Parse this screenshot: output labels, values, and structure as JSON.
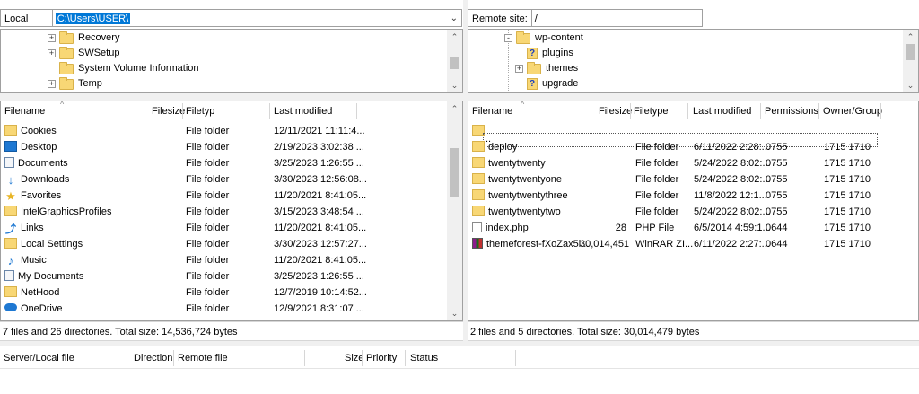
{
  "local": {
    "site_label": "Local site:",
    "path": "C:\\Users\\USER\\",
    "tree": [
      {
        "label": "Recovery",
        "expander": "+"
      },
      {
        "label": "SWSetup",
        "expander": "+"
      },
      {
        "label": "System Volume Information",
        "expander": ""
      },
      {
        "label": "Temp",
        "expander": "+"
      }
    ],
    "columns": {
      "name": "Filename",
      "size": "Filesize",
      "type": "Filetyp",
      "modified": "Last modified"
    },
    "files": [
      {
        "name": "Cookies",
        "size": "",
        "type": "File folder",
        "modified": "12/11/2021 11:11:4...",
        "icon": "folder-icon"
      },
      {
        "name": "Desktop",
        "size": "",
        "type": "File folder",
        "modified": "2/19/2023 3:02:38 ...",
        "icon": "desktop-icon"
      },
      {
        "name": "Documents",
        "size": "",
        "type": "File folder",
        "modified": "3/25/2023 1:26:55 ...",
        "icon": "documents-icon"
      },
      {
        "name": "Downloads",
        "size": "",
        "type": "File folder",
        "modified": "3/30/2023 12:56:08...",
        "icon": "download-icon"
      },
      {
        "name": "Favorites",
        "size": "",
        "type": "File folder",
        "modified": "11/20/2021 8:41:05...",
        "icon": "star-icon"
      },
      {
        "name": "IntelGraphicsProfiles",
        "size": "",
        "type": "File folder",
        "modified": "3/15/2023 3:48:54 ...",
        "icon": "folder-icon"
      },
      {
        "name": "Links",
        "size": "",
        "type": "File folder",
        "modified": "11/20/2021 8:41:05...",
        "icon": "link-icon"
      },
      {
        "name": "Local Settings",
        "size": "",
        "type": "File folder",
        "modified": "3/30/2023 12:57:27...",
        "icon": "folder-icon"
      },
      {
        "name": "Music",
        "size": "",
        "type": "File folder",
        "modified": "11/20/2021 8:41:05...",
        "icon": "music-icon"
      },
      {
        "name": "My Documents",
        "size": "",
        "type": "File folder",
        "modified": "3/25/2023 1:26:55 ...",
        "icon": "documents-icon"
      },
      {
        "name": "NetHood",
        "size": "",
        "type": "File folder",
        "modified": "12/7/2019 10:14:52...",
        "icon": "folder-icon"
      },
      {
        "name": "OneDrive",
        "size": "",
        "type": "File folder",
        "modified": "12/9/2021 8:31:07 ...",
        "icon": "cloud-icon"
      }
    ],
    "status": "7 files and 26 directories. Total size: 14,536,724 bytes"
  },
  "remote": {
    "site_label": "Remote site:",
    "path": "/",
    "tree": [
      {
        "label": "wp-content",
        "kind": "folder",
        "expander": "-"
      },
      {
        "label": "plugins",
        "kind": "unknown",
        "expander": ""
      },
      {
        "label": "themes",
        "kind": "folder",
        "expander": "+"
      },
      {
        "label": "upgrade",
        "kind": "unknown",
        "expander": ""
      }
    ],
    "columns": {
      "name": "Filename",
      "size": "Filesize",
      "type": "Filetype",
      "modified": "Last modified",
      "permissions": "Permissions",
      "owner": "Owner/Group"
    },
    "files": [
      {
        "name": "..",
        "size": "",
        "type": "",
        "modified": "",
        "permissions": "",
        "owner": "",
        "icon": "folder-icon"
      },
      {
        "name": "deploy",
        "size": "",
        "type": "File folder",
        "modified": "6/11/2022 2:28:...",
        "permissions": "0755",
        "owner": "1715 1710",
        "icon": "folder-icon"
      },
      {
        "name": "twentytwenty",
        "size": "",
        "type": "File folder",
        "modified": "5/24/2022 8:02:...",
        "permissions": "0755",
        "owner": "1715 1710",
        "icon": "folder-icon"
      },
      {
        "name": "twentytwentyone",
        "size": "",
        "type": "File folder",
        "modified": "5/24/2022 8:02:...",
        "permissions": "0755",
        "owner": "1715 1710",
        "icon": "folder-icon"
      },
      {
        "name": "twentytwentythree",
        "size": "",
        "type": "File folder",
        "modified": "11/8/2022 12:1...",
        "permissions": "0755",
        "owner": "1715 1710",
        "icon": "folder-icon"
      },
      {
        "name": "twentytwentytwo",
        "size": "",
        "type": "File folder",
        "modified": "5/24/2022 8:02:...",
        "permissions": "0755",
        "owner": "1715 1710",
        "icon": "folder-icon"
      },
      {
        "name": "index.php",
        "size": "28",
        "type": "PHP File",
        "modified": "6/5/2014 4:59:1...",
        "permissions": "0644",
        "owner": "1715 1710",
        "icon": "file-icon"
      },
      {
        "name": "themeforest-fXoZax5l...",
        "size": "30,014,451",
        "type": "WinRAR ZI...",
        "modified": "6/11/2022 2:27:...",
        "permissions": "0644",
        "owner": "1715 1710",
        "icon": "archive-icon"
      }
    ],
    "status": "2 files and 5 directories. Total size: 30,014,479 bytes"
  },
  "queue": {
    "columns": {
      "server": "Server/Local file",
      "direction": "Direction",
      "remote": "Remote file",
      "size": "Size",
      "priority": "Priority",
      "status": "Status"
    }
  }
}
